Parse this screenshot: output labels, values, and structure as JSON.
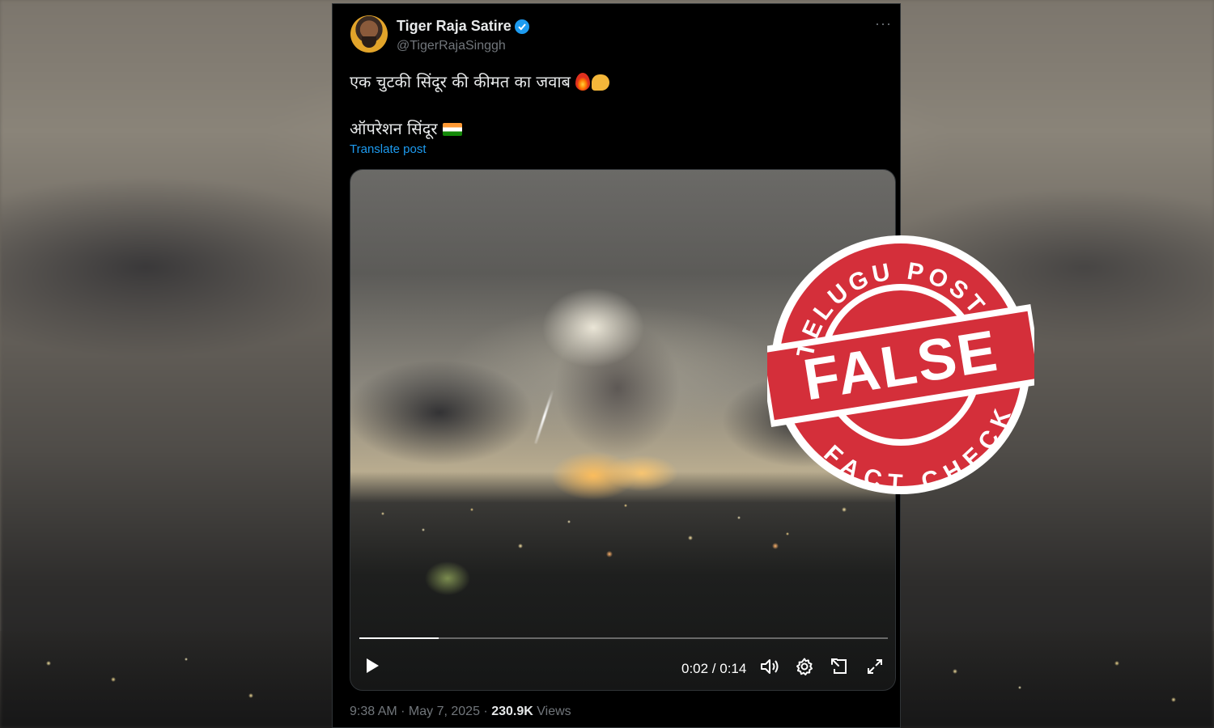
{
  "tweet": {
    "author_name": "Tiger Raja Satire",
    "author_handle": "@TigerRajaSinggh",
    "more_icon": "more-horizontal-icon",
    "line1": "एक चुटकी सिंदूर की कीमत का जवाब",
    "line2": "ऑपरेशन सिंदूर",
    "translate_label": "Translate post",
    "timestamp": "9:38 AM · May 7, 2025 ·",
    "views_count": "230.9K",
    "views_label": "Views"
  },
  "video": {
    "time": "0:02 / 0:14",
    "progress": 0.15,
    "icons": [
      "play-icon",
      "volume-icon",
      "gear-icon",
      "pip-icon",
      "fullscreen-icon"
    ]
  },
  "stamp": {
    "top_text": "TELUGU POST",
    "main_text": "FALSE",
    "bottom_text": "FACT CHECK",
    "color": "#d42f3a"
  },
  "colors": {
    "link": "#1d9bf0",
    "text": "#e7e9ea",
    "secondary": "#71767b",
    "background": "#000000"
  }
}
